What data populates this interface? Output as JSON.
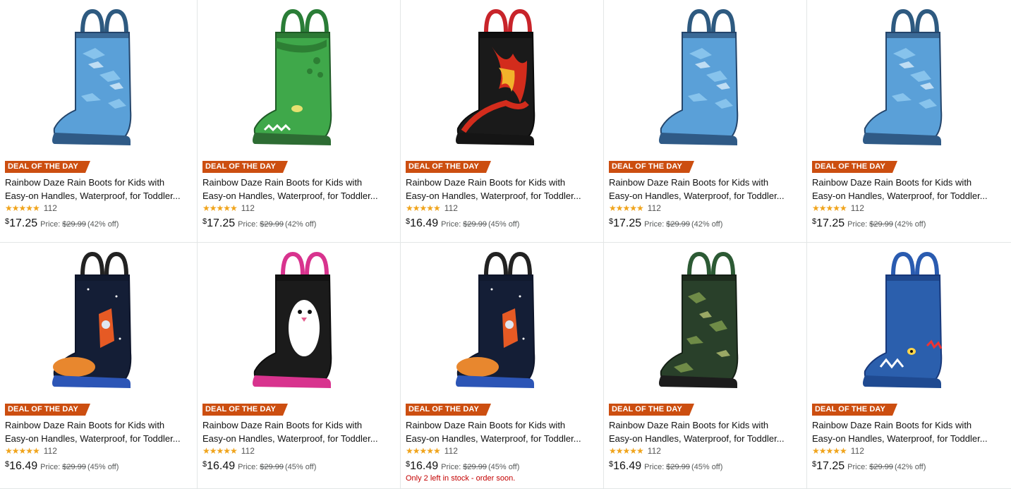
{
  "products": [
    {
      "badge": "DEAL OF THE DAY",
      "title_line1": "Rainbow Daze Rain Boots for Kids with",
      "title_line2": "Easy-on Handles, Waterproof, for Toddler...",
      "rating_count": "112",
      "currency": "$",
      "price": "17.25",
      "list_label": "Price:",
      "list_price": "$29.99",
      "discount": "(42% off)",
      "stock": "",
      "style": "camo-blue",
      "rating": 4.5
    },
    {
      "badge": "DEAL OF THE DAY",
      "title_line1": "Rainbow Daze Rain Boots for Kids with",
      "title_line2": "Easy-on Handles, Waterproof, for Toddler...",
      "rating_count": "112",
      "currency": "$",
      "price": "17.25",
      "list_label": "Price:",
      "list_price": "$29.99",
      "discount": "(42% off)",
      "stock": "",
      "style": "green-dino",
      "rating": 4.5
    },
    {
      "badge": "DEAL OF THE DAY",
      "title_line1": "Rainbow Daze Rain Boots for Kids with",
      "title_line2": "Easy-on Handles, Waterproof, for Toddler...",
      "rating_count": "112",
      "currency": "$",
      "price": "16.49",
      "list_label": "Price:",
      "list_price": "$29.99",
      "discount": "(45% off)",
      "stock": "",
      "style": "fire",
      "rating": 4.5
    },
    {
      "badge": "DEAL OF THE DAY",
      "title_line1": "Rainbow Daze Rain Boots for Kids with",
      "title_line2": "Easy-on Handles, Waterproof, for Toddler...",
      "rating_count": "112",
      "currency": "$",
      "price": "17.25",
      "list_label": "Price:",
      "list_price": "$29.99",
      "discount": "(42% off)",
      "stock": "",
      "style": "camo-blue",
      "rating": 4.5
    },
    {
      "badge": "DEAL OF THE DAY",
      "title_line1": "Rainbow Daze Rain Boots for Kids with",
      "title_line2": "Easy-on Handles, Waterproof, for Toddler...",
      "rating_count": "112",
      "currency": "$",
      "price": "17.25",
      "list_label": "Price:",
      "list_price": "$29.99",
      "discount": "(42% off)",
      "stock": "",
      "style": "camo-blue",
      "rating": 4.5
    },
    {
      "badge": "DEAL OF THE DAY",
      "title_line1": "Rainbow Daze Rain Boots for Kids with",
      "title_line2": "Easy-on Handles, Waterproof, for Toddler...",
      "rating_count": "112",
      "currency": "$",
      "price": "16.49",
      "list_label": "Price:",
      "list_price": "$29.99",
      "discount": "(45% off)",
      "stock": "",
      "style": "space",
      "rating": 4.5
    },
    {
      "badge": "DEAL OF THE DAY",
      "title_line1": "Rainbow Daze Rain Boots for Kids with",
      "title_line2": "Easy-on Handles, Waterproof, for Toddler...",
      "rating_count": "112",
      "currency": "$",
      "price": "16.49",
      "list_label": "Price:",
      "list_price": "$29.99",
      "discount": "(45% off)",
      "stock": "",
      "style": "penguin",
      "rating": 4.5
    },
    {
      "badge": "DEAL OF THE DAY",
      "title_line1": "Rainbow Daze Rain Boots for Kids with",
      "title_line2": "Easy-on Handles, Waterproof, for Toddler...",
      "rating_count": "112",
      "currency": "$",
      "price": "16.49",
      "list_label": "Price:",
      "list_price": "$29.99",
      "discount": "(45% off)",
      "stock": "Only 2 left in stock - order soon.",
      "style": "space",
      "rating": 4.5
    },
    {
      "badge": "DEAL OF THE DAY",
      "title_line1": "Rainbow Daze Rain Boots for Kids with",
      "title_line2": "Easy-on Handles, Waterproof, for Toddler...",
      "rating_count": "112",
      "currency": "$",
      "price": "16.49",
      "list_label": "Price:",
      "list_price": "$29.99",
      "discount": "(45% off)",
      "stock": "",
      "style": "army",
      "rating": 4.5
    },
    {
      "badge": "DEAL OF THE DAY",
      "title_line1": "Rainbow Daze Rain Boots for Kids with",
      "title_line2": "Easy-on Handles, Waterproof, for Toddler...",
      "rating_count": "112",
      "currency": "$",
      "price": "17.25",
      "list_label": "Price:",
      "list_price": "$29.99",
      "discount": "(42% off)",
      "stock": "",
      "style": "blue-shark",
      "rating": 4.5
    }
  ],
  "colors": {
    "badge": "#cc4e10",
    "star": "#f0a41c",
    "stock_warning": "#c40000",
    "muted_text": "#565959"
  }
}
